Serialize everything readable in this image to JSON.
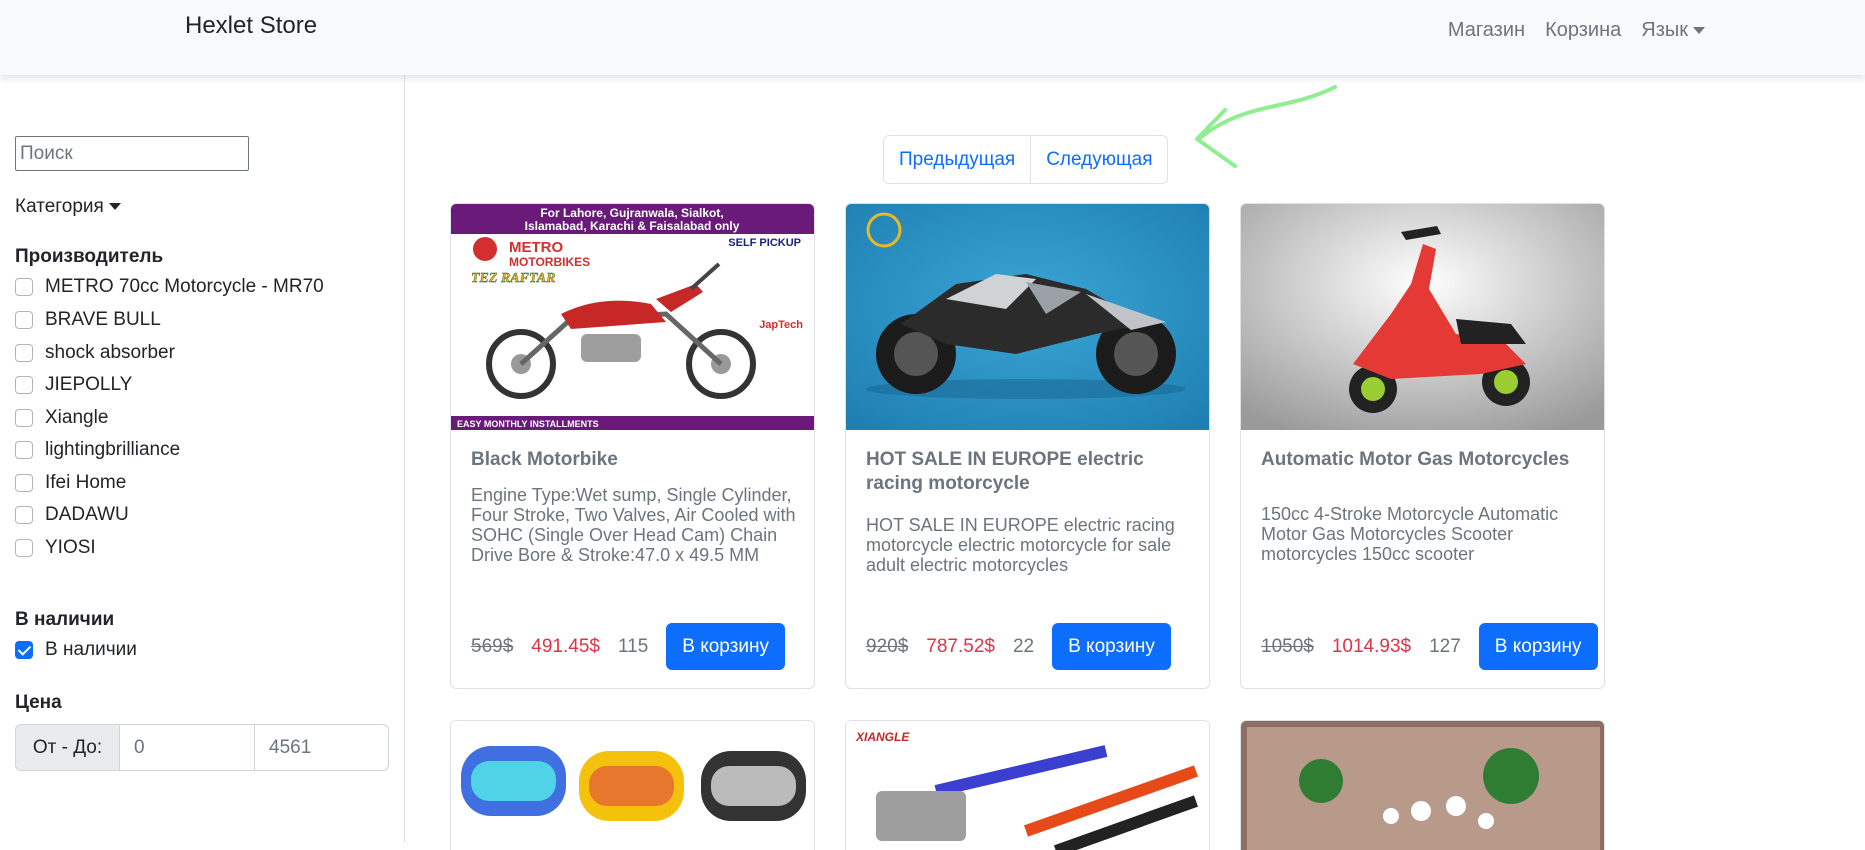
{
  "navbar": {
    "brand": "Hexlet Store",
    "links": {
      "shop": "Магазин",
      "cart": "Корзина",
      "language": "Язык"
    }
  },
  "sidebar": {
    "search_placeholder": "Поиск",
    "category_label": "Категория",
    "manufacturer_heading": "Производитель",
    "manufacturers": [
      "METRO 70cc Motorcycle - MR70",
      "BRAVE BULL",
      "shock absorber",
      "JIEPOLLY",
      "Xiangle",
      "lightingbrilliance",
      "Ifei Home",
      "DADAWU",
      "YIOSI"
    ],
    "stock_heading": "В наличии",
    "stock_checkbox_label": "В наличии",
    "stock_checked": true,
    "price_heading": "Цена",
    "price_range_label": "От - До:",
    "price_min": "0",
    "price_max": "4561"
  },
  "pagination": {
    "prev": "Предыдущая",
    "next": "Следующая"
  },
  "products": [
    {
      "title": "Black Motorbike",
      "description": "Engine Type:Wet sump, Single Cylinder, Four Stroke, Two Valves, Air Cooled with SOHC (Single Over Head Cam) Chain Drive Bore & Stroke:47.0 x 49.5 MM",
      "old_price": "569$",
      "new_price": "491.45$",
      "stock": "115",
      "button": "В корзину",
      "banner_line1": "For Lahore, Gujranwala, Sialkot,",
      "banner_line2": "Islamabad, Karachi & Faisalabad only",
      "brand_line1": "METRO",
      "brand_line2": "MOTORBIKES",
      "self_pickup": "SELF PICKUP",
      "model": "TEZ RAFTAR",
      "jap_tech": "JapTech",
      "installments": "EASY MONTHLY INSTALLMENTS"
    },
    {
      "title": "HOT SALE IN EUROPE electric racing motorcycle",
      "description": "HOT SALE IN EUROPE electric racing motorcycle electric motorcycle for sale adult electric motorcycles",
      "old_price": "920$",
      "new_price": "787.52$",
      "stock": "22",
      "button": "В корзину"
    },
    {
      "title": "Automatic Motor Gas Motorcycles",
      "description": "150cc 4-Stroke Motorcycle Automatic Motor Gas Motorcycles Scooter motorcycles 150cc scooter",
      "old_price": "1050$",
      "new_price": "1014.93$",
      "stock": "127",
      "button": "В корзину"
    }
  ],
  "second_row": [
    {
      "image": "goggles"
    },
    {
      "image": "tie-down-straps",
      "brand": "XIANGLE"
    },
    {
      "image": "hanging-lights-plants"
    }
  ],
  "colors": {
    "primary": "#0d6efd",
    "sale_price": "#dc3545",
    "muted": "#6c757d",
    "annotation_arrow": "#90ee90"
  }
}
